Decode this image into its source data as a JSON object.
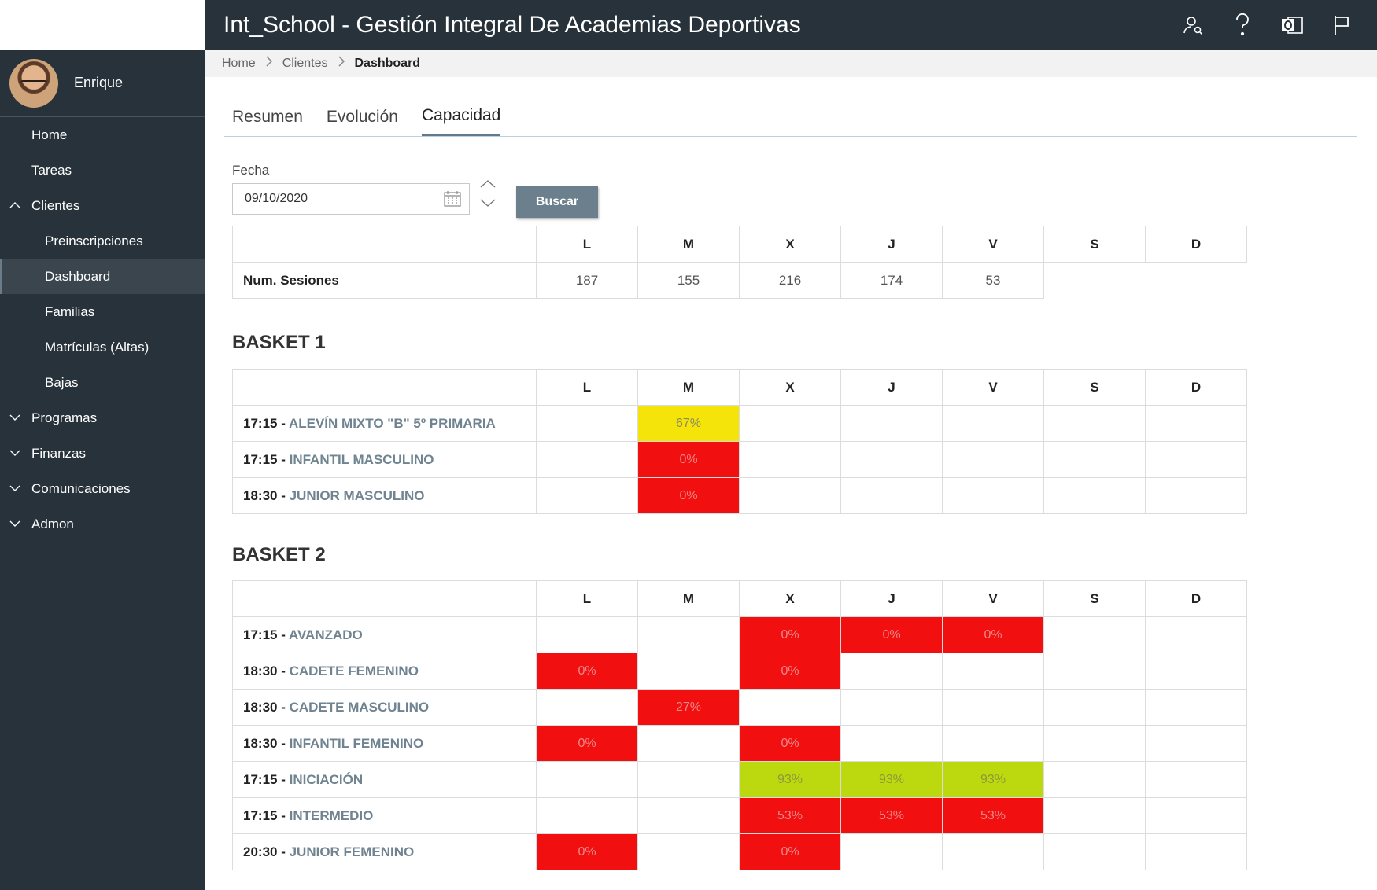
{
  "header": {
    "title": "Int_School - Gestión Integral De Academias Deportivas",
    "icons": [
      "user-search-icon",
      "help-icon",
      "outlook-icon",
      "flag-icon"
    ]
  },
  "user": {
    "name": "Enrique"
  },
  "sidebar": {
    "items": [
      {
        "label": "Home"
      },
      {
        "label": "Tareas"
      },
      {
        "label": "Clientes",
        "expanded": true
      },
      {
        "label": "Preinscripciones"
      },
      {
        "label": "Dashboard",
        "active": true
      },
      {
        "label": "Familias"
      },
      {
        "label": "Matrículas (Altas)"
      },
      {
        "label": "Bajas"
      },
      {
        "label": "Programas"
      },
      {
        "label": "Finanzas"
      },
      {
        "label": "Comunicaciones"
      },
      {
        "label": "Admon"
      }
    ]
  },
  "breadcrumb": {
    "items": [
      "Home",
      "Clientes",
      "Dashboard"
    ]
  },
  "tabs": [
    "Resumen",
    "Evolución",
    "Capacidad"
  ],
  "filter": {
    "label": "Fecha",
    "date": "09/10/2020",
    "search_label": "Buscar"
  },
  "days": [
    "L",
    "M",
    "X",
    "J",
    "V",
    "S",
    "D"
  ],
  "summary": {
    "label": "Num. Sesiones",
    "values": [
      "187",
      "155",
      "216",
      "174",
      "53",
      "",
      ""
    ]
  },
  "sections": [
    {
      "title": "BASKET 1",
      "rows": [
        {
          "time": "17:15 - ",
          "group": "ALEVÍN MIXTO \"B\" 5º PRIMARIA",
          "cells": [
            "",
            "67%",
            "",
            "",
            "",
            "",
            ""
          ]
        },
        {
          "time": "17:15 - ",
          "group": "INFANTIL MASCULINO",
          "cells": [
            "",
            "0%",
            "",
            "",
            "",
            "",
            ""
          ]
        },
        {
          "time": "18:30 - ",
          "group": "JUNIOR MASCULINO",
          "cells": [
            "",
            "0%",
            "",
            "",
            "",
            "",
            ""
          ]
        }
      ]
    },
    {
      "title": "BASKET 2",
      "rows": [
        {
          "time": "17:15 - ",
          "group": "AVANZADO",
          "cells": [
            "",
            "",
            "0%",
            "0%",
            "0%",
            "",
            ""
          ]
        },
        {
          "time": "18:30 - ",
          "group": "CADETE FEMENINO",
          "cells": [
            "0%",
            "",
            "0%",
            "",
            "",
            "",
            ""
          ]
        },
        {
          "time": "18:30 - ",
          "group": "CADETE MASCULINO",
          "cells": [
            "",
            "27%",
            "",
            "",
            "",
            "",
            ""
          ]
        },
        {
          "time": "18:30 - ",
          "group": "INFANTIL FEMENINO",
          "cells": [
            "0%",
            "",
            "0%",
            "",
            "",
            "",
            ""
          ]
        },
        {
          "time": "17:15 - ",
          "group": "INICIACIÓN",
          "cells": [
            "",
            "",
            "93%",
            "93%",
            "93%",
            "",
            ""
          ]
        },
        {
          "time": "17:15 - ",
          "group": "INTERMEDIO",
          "cells": [
            "",
            "",
            "53%",
            "53%",
            "53%",
            "",
            ""
          ]
        },
        {
          "time": "20:30 - ",
          "group": "JUNIOR FEMENINO",
          "cells": [
            "0%",
            "",
            "0%",
            "",
            "",
            "",
            ""
          ]
        }
      ]
    }
  ],
  "colors": {
    "high": "#bcd90f",
    "mid": "#f5e40a",
    "low": "#f20f0f",
    "sidebar": "#28323a"
  }
}
